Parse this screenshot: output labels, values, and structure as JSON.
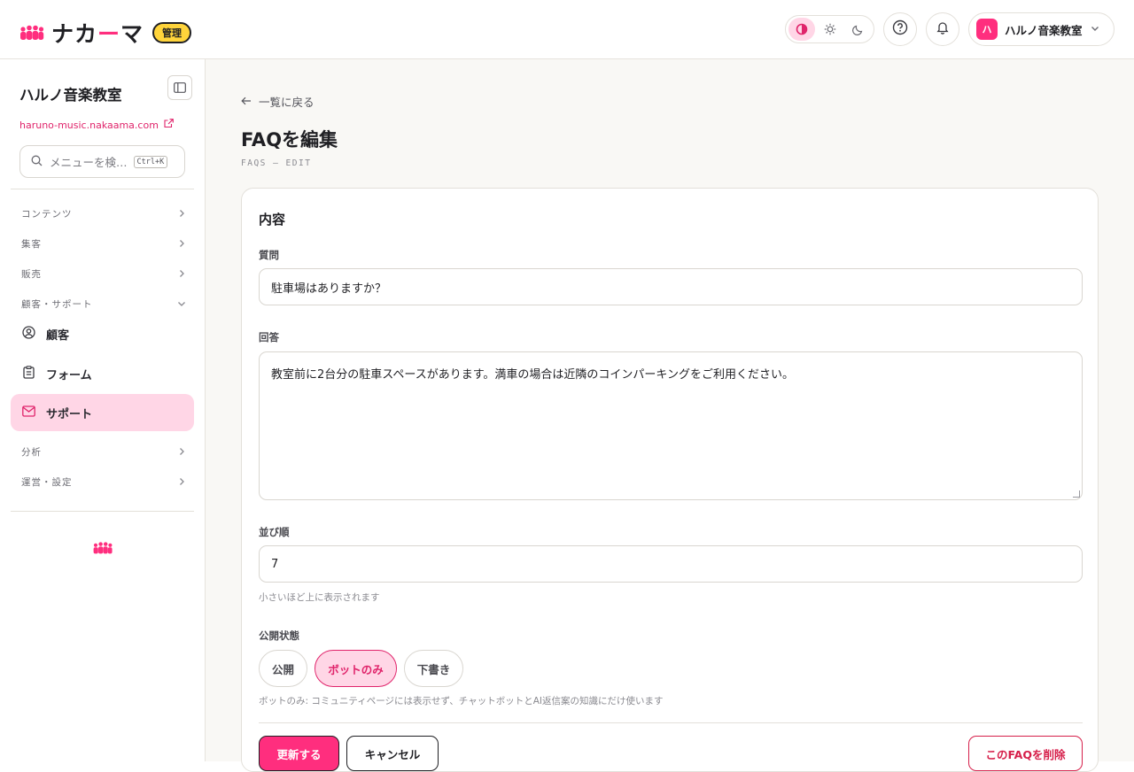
{
  "header": {
    "logo_text_a": "ナカ",
    "logo_text_dash": "ー",
    "logo_text_b": "マ",
    "badge": "管理",
    "account_initial": "ハ",
    "account_name": "ハルノ音楽教室"
  },
  "sidebar": {
    "site_title": "ハルノ音楽教室",
    "site_url": "haruno-music.nakaama.com",
    "search_placeholder": "メニューを検…",
    "search_shortcut": "Ctrl+K",
    "groups": {
      "content": "コンテンツ",
      "marketing": "集客",
      "sales": "販売",
      "customer_support": "顧客・サポート",
      "analytics": "分析",
      "operations": "運営・設定"
    },
    "items": {
      "customers": "顧客",
      "forms": "フォーム",
      "support": "サポート"
    }
  },
  "main": {
    "back_link": "一覧に戻る",
    "title": "FAQを編集",
    "subtitle": "FAQS — EDIT",
    "card_title": "内容",
    "question_label": "質問",
    "question_value": "駐車場はありますか？",
    "answer_label": "回答",
    "answer_value": "教室前に2台分の駐車スペースがあります。満車の場合は近隣のコインパーキングをご利用ください。",
    "order_label": "並び順",
    "order_value": "7",
    "order_hint": "小さいほど上に表示されます",
    "status_label": "公開状態",
    "status_options": [
      "公開",
      "ボットのみ",
      "下書き"
    ],
    "status_selected": "ボットのみ",
    "status_hint": "ボットのみ: コミュニティページには表示せず、チャットボットとAI返信案の知識にだけ使います",
    "update_button": "更新する",
    "cancel_button": "キャンセル",
    "delete_button": "このFAQを削除"
  },
  "colors": {
    "accent": "#ff2e7e",
    "accent_soft": "#ffd6e6",
    "badge_yellow": "#ffd43b",
    "danger": "#d61f4a"
  },
  "icons": [
    "people-logo-icon",
    "contrast-icon",
    "sun-icon",
    "moon-icon",
    "help-icon",
    "bell-icon",
    "chevron-down-icon",
    "sidebar-toggle-icon",
    "external-link-icon",
    "search-icon",
    "chevron-right-icon",
    "user-circle-icon",
    "clipboard-icon",
    "mail-icon",
    "arrow-left-icon"
  ]
}
